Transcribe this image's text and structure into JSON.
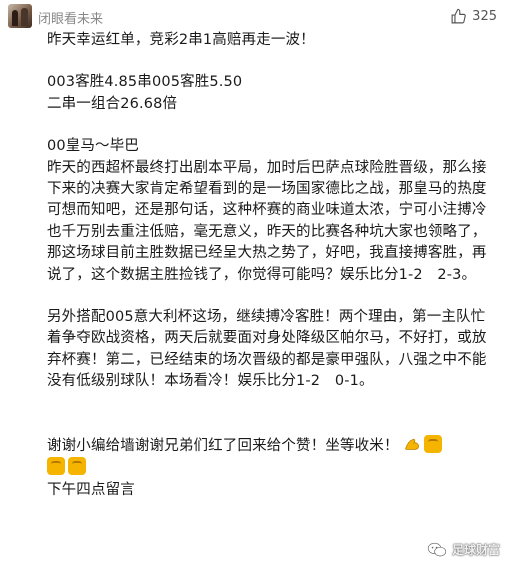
{
  "comment": {
    "username": "闭眼看未来",
    "like_count": "325",
    "paragraphs": [
      "昨天幸运红单，竞彩2串1高赔再走一波！",
      "003客胜4.85串005客胜5.50\n二串一组合26.68倍",
      "00皇马～毕巴\n昨天的西超杯最终打出剧本平局，加时后巴萨点球险胜晋级，那么接下来的决赛大家肯定希望看到的是一场国家德比之战，那皇马的热度可想而知吧，还是那句话，这种杯赛的商业味道太浓，宁可小注搏冷也千万别去重注低赔，毫无意义，昨天的比赛各种坑大家也领略了，那这场球目前主胜数据已经呈大热之势了，好吧，我直接搏客胜，再说了，这个数据主胜捡钱了，你觉得可能吗？娱乐比分1-2　2-3。",
      "另外搭配005意大利杯这场，继续搏冷客胜！两个理由，第一主队忙着争夺欧战资格，两天后就要面对身处降级区帕尔马，不好打，或放弃杯赛！第二，已经结束的场次晋级的都是豪甲强队，八强之中不能没有低级别球队！本场看冷！娱乐比分1-2　0-1。"
    ],
    "closing_line": "谢谢小编给墙谢谢兄弟们红了回来给个赞！坐等收米！",
    "closing_emojis": [
      "muscle-emoji",
      "fist-emoji",
      "fist-emoji",
      "fist-emoji"
    ],
    "time_note": "下午四点留言"
  },
  "watermark": {
    "text": "足球财富"
  },
  "colors": {
    "username": "#888888",
    "text": "#1a1a1a",
    "accent": "#f5b400"
  }
}
